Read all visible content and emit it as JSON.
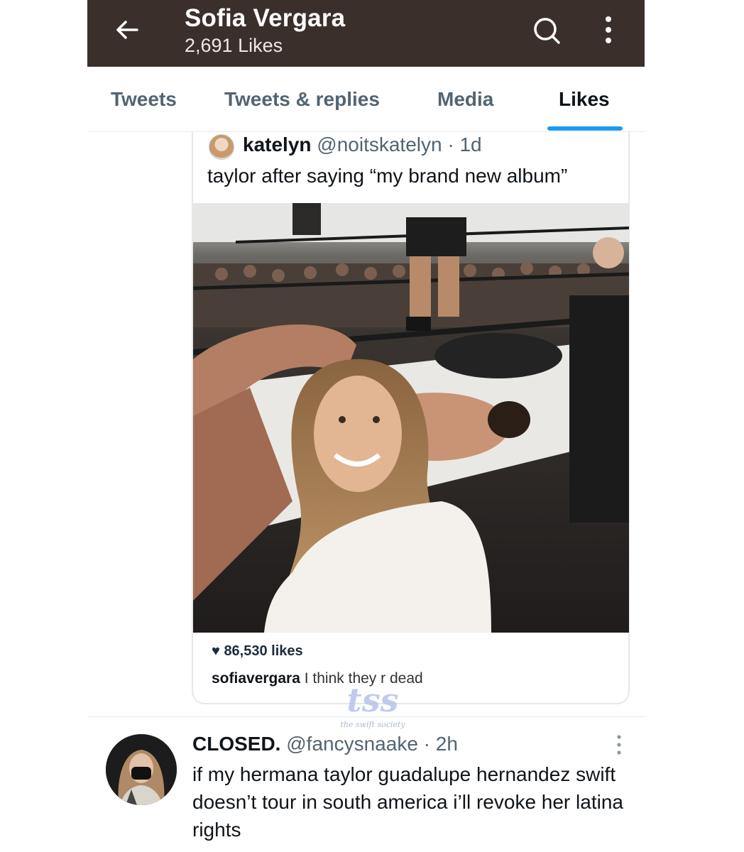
{
  "header": {
    "title": "Sofia Vergara",
    "subtitle": "2,691 Likes",
    "back_icon": "arrow-left-icon",
    "search_icon": "search-icon",
    "more_icon": "more-vertical-icon"
  },
  "tabs": [
    {
      "label": "Tweets"
    },
    {
      "label": "Tweets & replies"
    },
    {
      "label": "Media"
    },
    {
      "label": "Likes",
      "active": true
    }
  ],
  "quoted_tweet": {
    "name": "katelyn",
    "handle": "@noitskatelyn",
    "time": "· 1d",
    "text": "taylor after saying “my brand new album”",
    "image": {
      "likes": "86,530 likes",
      "caption_user": "sofiavergara",
      "caption_text": "I think they r dead"
    }
  },
  "watermark": {
    "big": "tss",
    "small": "the swift society"
  },
  "tweet": {
    "name": "CLOSED.",
    "handle": "@fancysnaake",
    "time": "· 2h",
    "text": "if my hermana taylor guadalupe hernandez swift doesn’t tour in south america i’ll revoke her latina rights"
  },
  "colors": {
    "header_bg": "#3b2f2c",
    "accent": "#1d9bf0",
    "secondary_text": "#536471"
  }
}
